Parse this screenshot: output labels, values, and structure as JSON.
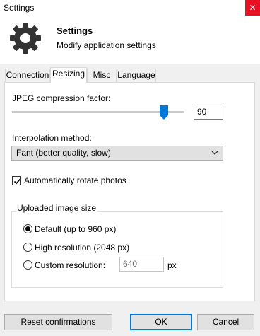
{
  "window": {
    "title": "Settings",
    "close_glyph": "✕"
  },
  "header": {
    "title": "Settings",
    "subtitle": "Modify application settings",
    "icon": "gear-icon"
  },
  "tabs": [
    {
      "label": "Connection",
      "active": false
    },
    {
      "label": "Resizing",
      "active": true
    },
    {
      "label": "Misc",
      "active": false
    },
    {
      "label": "Language",
      "active": false
    }
  ],
  "resizing": {
    "jpeg_label": "JPEG compression factor:",
    "jpeg_value": "90",
    "jpeg_slider_fraction": 0.9,
    "interpolation_label": "Interpolation method:",
    "interpolation_selected": "Fant (better quality, slow)",
    "auto_rotate_label": "Automatically rotate photos",
    "auto_rotate_checked": true,
    "uploaded_size": {
      "title": "Uploaded image size",
      "options": [
        {
          "label": "Default (up to 960 px)",
          "selected": true
        },
        {
          "label": "High resolution (2048 px)",
          "selected": false
        },
        {
          "label": "Custom resolution:",
          "selected": false
        }
      ],
      "custom_value": "640",
      "unit": "px"
    }
  },
  "buttons": {
    "reset": "Reset confirmations",
    "ok": "OK",
    "cancel": "Cancel"
  }
}
